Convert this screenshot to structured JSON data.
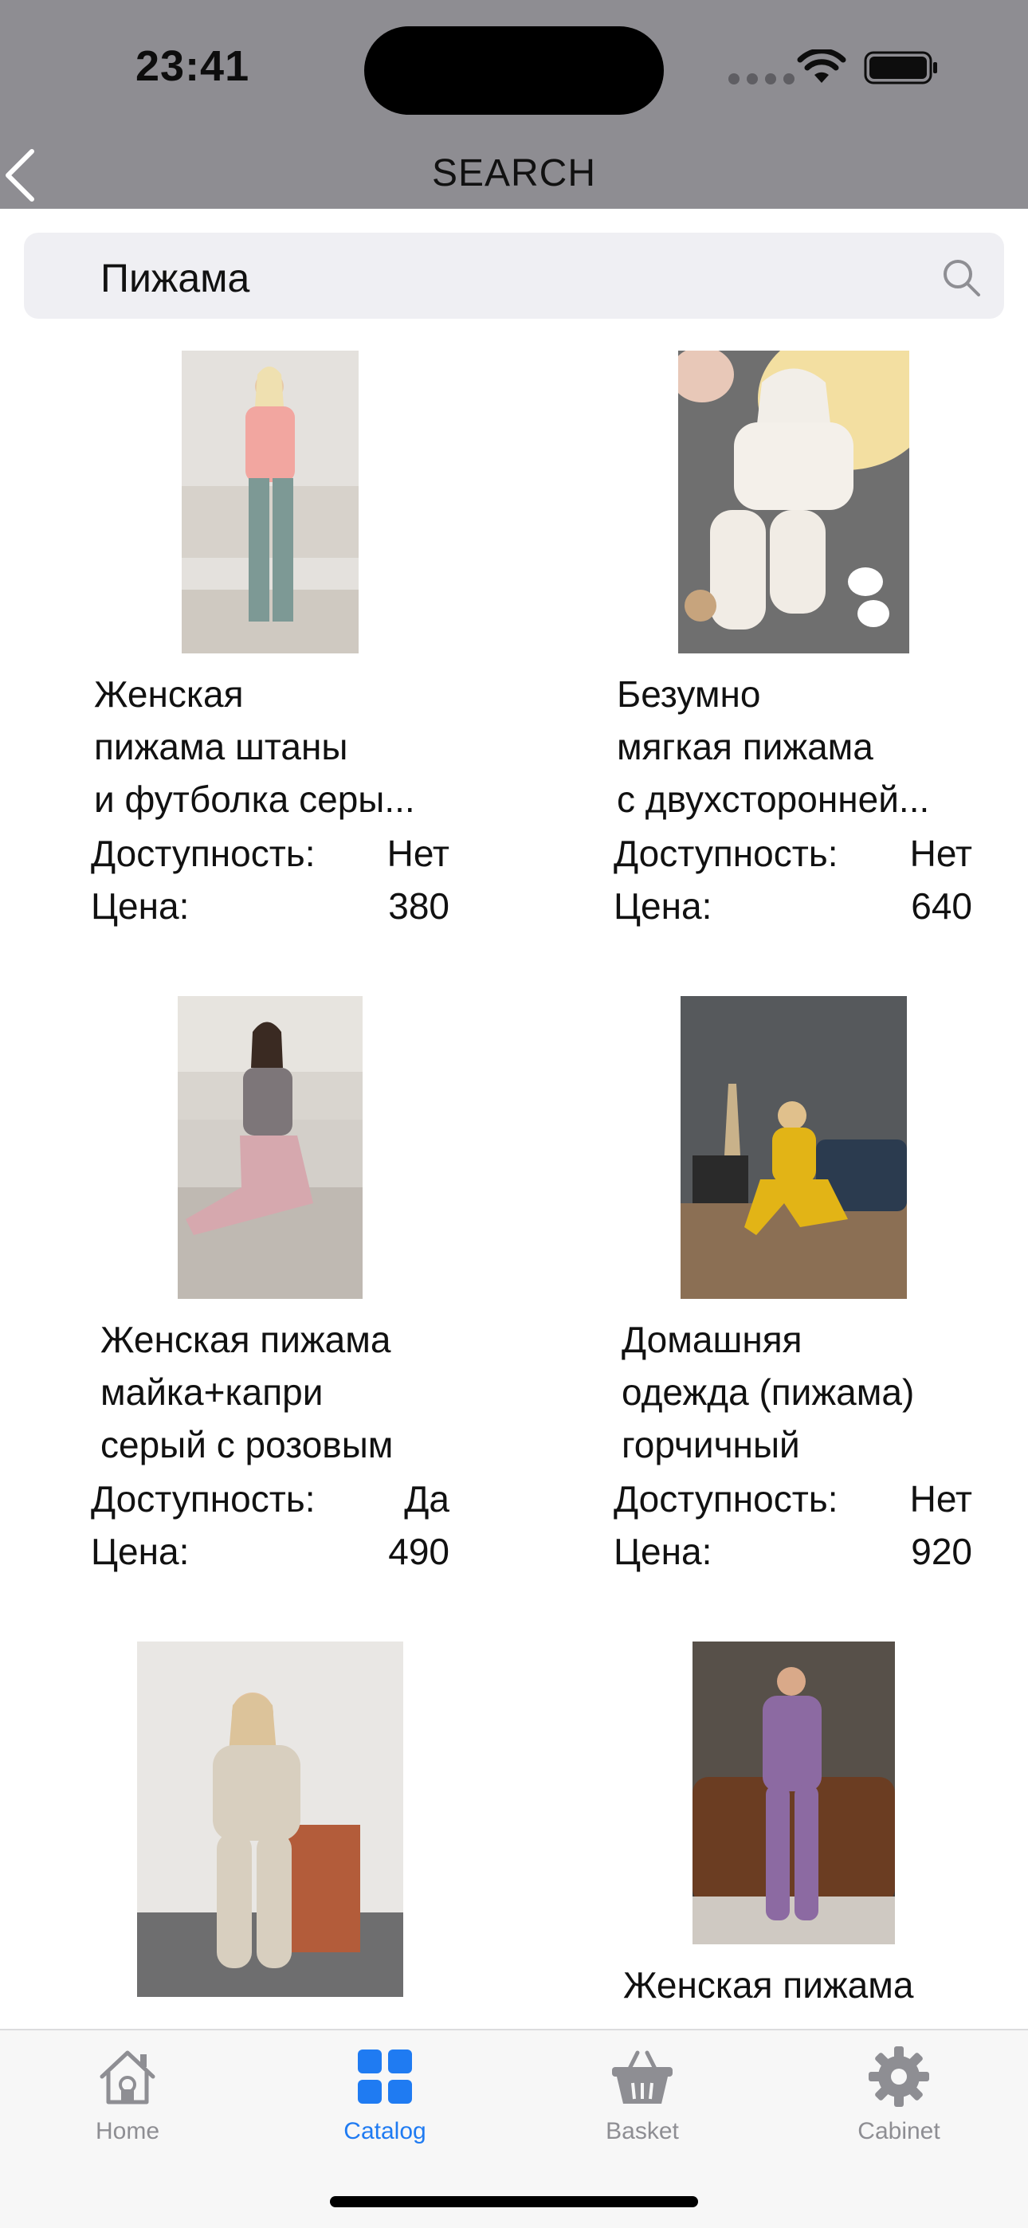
{
  "status_bar": {
    "time": "23:41"
  },
  "nav": {
    "title": "SEARCH"
  },
  "search": {
    "value": "Пижама"
  },
  "products": [
    {
      "name_lines": [
        "Женская",
        "пижама штаны",
        "и футболка серы..."
      ],
      "availability_label": "Доступность:",
      "availability": "Нет",
      "price_label": "Цена:",
      "price": "380"
    },
    {
      "name_lines": [
        "Безумно",
        "мягкая пижама",
        "с двухсторонней..."
      ],
      "availability_label": "Доступность:",
      "availability": "Нет",
      "price_label": "Цена:",
      "price": "640"
    },
    {
      "name_lines": [
        "Женская пижама",
        "майка+капри",
        "серый с розовым"
      ],
      "availability_label": "Доступность:",
      "availability": "Да",
      "price_label": "Цена:",
      "price": "490"
    },
    {
      "name_lines": [
        "Домашняя",
        "одежда (пижама)",
        "горчичный"
      ],
      "availability_label": "Доступность:",
      "availability": "Нет",
      "price_label": "Цена:",
      "price": "920"
    },
    {
      "name_lines": []
    },
    {
      "name_lines": [
        "Женская пижама"
      ]
    }
  ],
  "tabs": [
    {
      "label": "Home",
      "icon": "home-icon",
      "active": false
    },
    {
      "label": "Catalog",
      "icon": "grid-icon",
      "active": true
    },
    {
      "label": "Basket",
      "icon": "basket-icon",
      "active": false
    },
    {
      "label": "Cabinet",
      "icon": "gear-icon",
      "active": false
    }
  ],
  "colors": {
    "header": "#8e8d92",
    "accent": "#1f7bf2",
    "inactive_tab": "#8e8d92"
  }
}
